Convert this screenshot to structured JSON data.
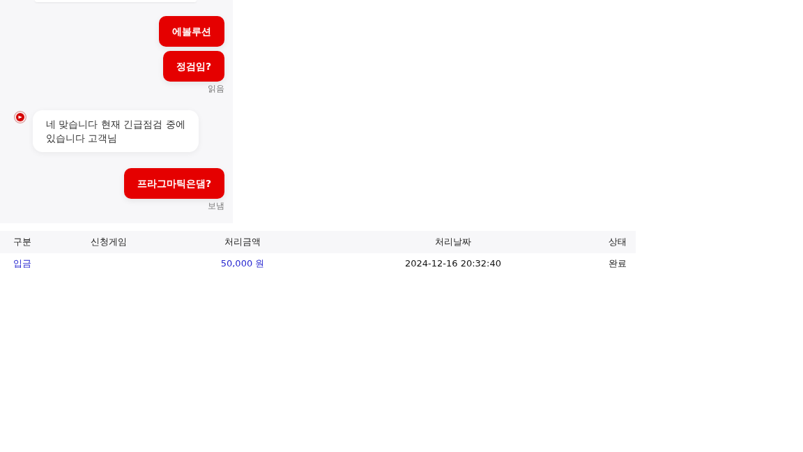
{
  "chat": {
    "messages": [
      {
        "kind": "clipped"
      },
      {
        "kind": "sent",
        "text": "에볼루션"
      },
      {
        "kind": "sent",
        "text": "정검임?",
        "status": "읽음"
      },
      {
        "kind": "received",
        "text": "네 맞습니다 현재 긴급점검 중에 있습니다 고객님"
      },
      {
        "kind": "sent",
        "text": "프라그마틱은댐?",
        "status": "보냄"
      }
    ]
  },
  "table": {
    "columns": [
      "구분",
      "신청게임",
      "처리금액",
      "처리날짜",
      "상태"
    ],
    "rows": [
      {
        "cells": [
          {
            "text": "입금",
            "kind": "link"
          },
          {
            "kind": "empty"
          },
          {
            "text": "50,000 원",
            "kind": "link"
          },
          {
            "text": "2024-12-16 20:32:40",
            "kind": "plain"
          },
          {
            "text": "완료",
            "kind": "plain"
          }
        ]
      }
    ]
  }
}
